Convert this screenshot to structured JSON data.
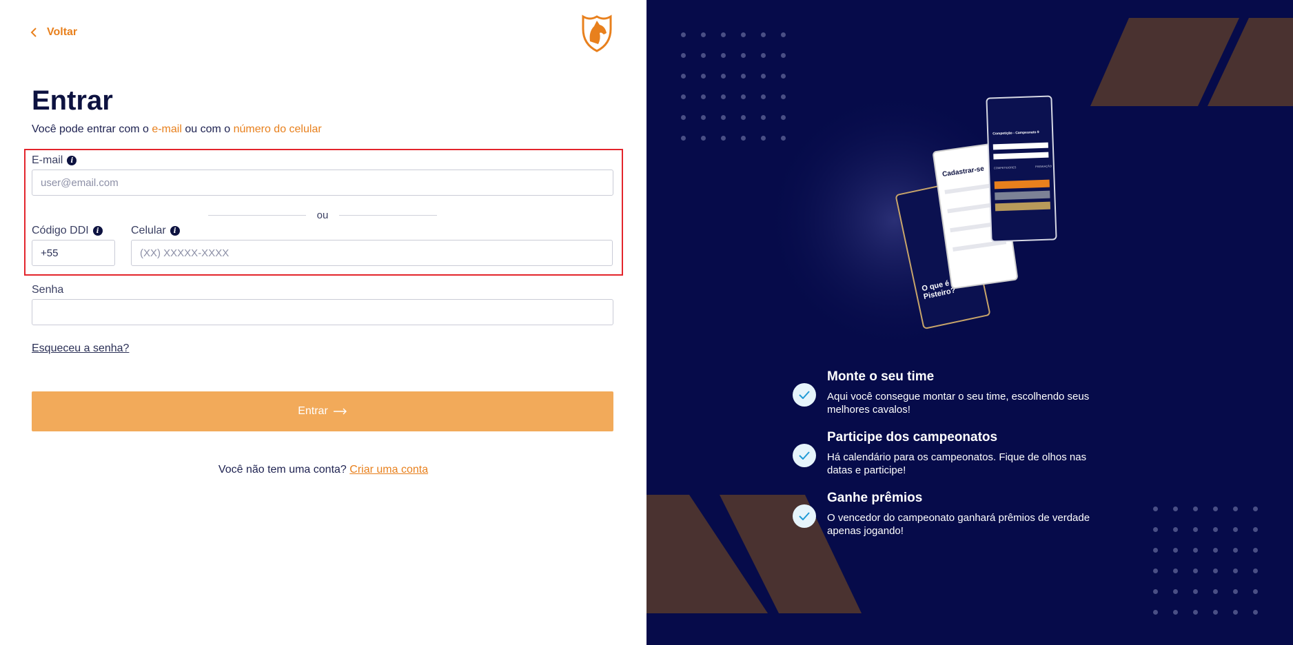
{
  "back": {
    "label": "Voltar"
  },
  "login": {
    "title": "Entrar",
    "subtitle": {
      "prefix": "Você pode entrar com o ",
      "email_link": "e-mail",
      "middle": " ou com o ",
      "phone_link": "número do celular"
    },
    "email": {
      "label": "E-mail",
      "placeholder": "user@email.com",
      "value": ""
    },
    "or": "ou",
    "ddi": {
      "label": "Código DDI",
      "value": "+55"
    },
    "phone": {
      "label": "Celular",
      "placeholder": "(XX) XXXXX-XXXX",
      "value": ""
    },
    "password": {
      "label": "Senha",
      "value": ""
    },
    "forgot": "Esqueceu a senha?",
    "submit": "Entrar",
    "signup": {
      "prefix": "Você não tem uma conta?",
      "link": "Criar uma conta"
    }
  },
  "mockups": {
    "screen_back": {
      "title": "O que é o Pisteiro?"
    },
    "screen_middle": {
      "title": "Cadastrar-se"
    },
    "screen_front": {
      "title": "Competição - Campeonato 9",
      "tabs": [
        "COMPETIDORES",
        "PREMIAÇÃO"
      ]
    }
  },
  "features": [
    {
      "title": "Monte o seu time",
      "text": "Aqui você consegue montar o seu time, escolhendo seus melhores cavalos!"
    },
    {
      "title": "Participe dos campeonatos",
      "text": "Há calendário para os campeonatos. Fique de olhos nas datas e participe!"
    },
    {
      "title": "Ganhe prêmios",
      "text": "O vencedor do campeonato ganhará prêmios de verdade apenas jogando!"
    }
  ],
  "colors": {
    "accent": "#e8801d",
    "button": "#f2aa5a",
    "panel_bg": "#060b4a",
    "highlight_border": "#e3242b",
    "shape": "#4a3230"
  },
  "icons": {
    "back": "chevron-left-icon",
    "logo": "horse-shield-logo",
    "info": "info-icon",
    "submit": "arrow-right-icon",
    "feature": "check-icon"
  }
}
